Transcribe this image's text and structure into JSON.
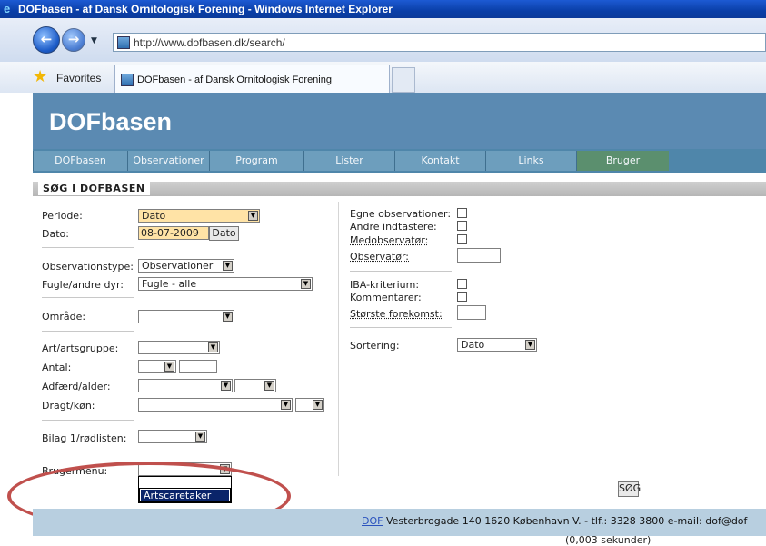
{
  "window": {
    "title": "DOFbasen - af Dansk Ornitologisk Forening - Windows Internet Explorer"
  },
  "browser": {
    "url": "http://www.dofbasen.dk/search/",
    "favorites_label": "Favorites",
    "tab_title": "DOFbasen - af Dansk Ornitologisk Forening"
  },
  "site": {
    "title": "DOFbasen",
    "nav": [
      "DOFbasen",
      "Observationer",
      "Program",
      "Lister",
      "Kontakt",
      "Links",
      "Bruger"
    ],
    "section_heading": "SØG I DOFBASEN"
  },
  "form_left": {
    "periode_label": "Periode:",
    "periode_value": "Dato",
    "dato_label": "Dato:",
    "dato_value": "08-07-2009",
    "dato_button": "Dato",
    "observationstype_label": "Observationstype:",
    "observationstype_value": "Observationer",
    "fugle_label": "Fugle/andre dyr:",
    "fugle_value": "Fugle - alle",
    "omraade_label": "Område:",
    "art_label": "Art/artsgruppe:",
    "antal_label": "Antal:",
    "adfaerd_label": "Adfærd/alder:",
    "dragt_label": "Dragt/køn:",
    "bilag_label": "Bilag 1/rødlisten:",
    "brugermenu_label": "Brugermenu:",
    "brugermenu_option": "Artscaretaker"
  },
  "form_right": {
    "egne_label": "Egne observationer:",
    "andre_label": "Andre indtastere:",
    "medobservator_label": "Medobservatør:",
    "observator_label": "Observatør:",
    "iba_label": "IBA-kriterium:",
    "kommentarer_label": "Kommentarer:",
    "stoerste_label": "Største forekomst:",
    "sortering_label": "Sortering:",
    "sortering_value": "Dato",
    "search_button": "SØG"
  },
  "footer": {
    "link": "DOF",
    "text": " Vesterbrogade 140 1620 København V. - tlf.: 3328 3800 e-mail: dof@dof",
    "timing": "(0,003 sekunder)"
  }
}
